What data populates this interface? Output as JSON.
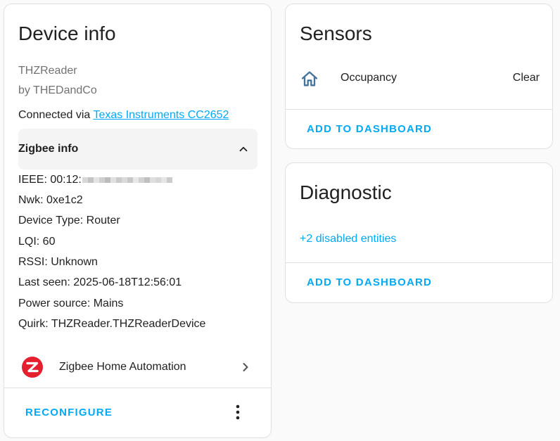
{
  "device_card": {
    "title": "Device info",
    "model": "THZReader",
    "manufacturer": "by THEDandCo",
    "connected_prefix": "Connected via ",
    "connected_link": "Texas Instruments CC2652",
    "zigbee_section_label": "Zigbee info",
    "zigbee_lines": {
      "ieee": "IEEE: 00:12:",
      "nwk": "Nwk: 0xe1c2",
      "device_type": "Device Type: Router",
      "lqi": "LQI: 60",
      "rssi": "RSSI: Unknown",
      "last_seen": "Last seen: 2025-06-18T12:56:01",
      "power_source": "Power source: Mains",
      "quirk": "Quirk: THZReader.THZReaderDevice"
    },
    "integration_label": "Zigbee Home Automation",
    "reconfigure_label": "RECONFIGURE"
  },
  "sensors_card": {
    "title": "Sensors",
    "entity_name": "Occupancy",
    "entity_state": "Clear",
    "entity_icon": "home-outline-icon",
    "add_to_dashboard": "ADD TO DASHBOARD"
  },
  "diagnostic_card": {
    "title": "Diagnostic",
    "disabled_entities_link": "+2 disabled entities",
    "add_to_dashboard": "ADD TO DASHBOARD"
  },
  "colors": {
    "accent": "#03a9f4",
    "zha_brand": "#e5202e",
    "sensor_icon": "#44739e"
  }
}
